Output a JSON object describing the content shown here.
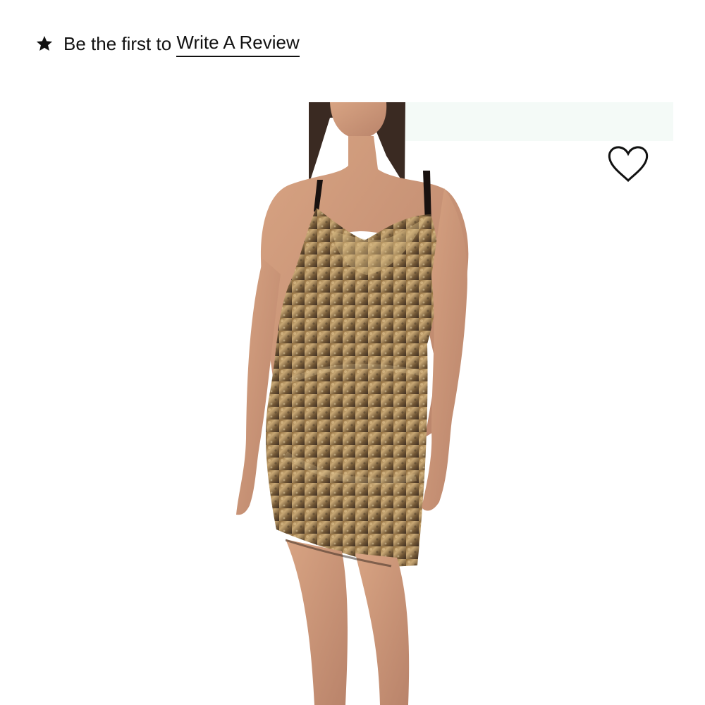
{
  "review": {
    "star_icon": "star-icon",
    "prefix": "Be the first to ",
    "link_label": "Write A Review"
  },
  "product": {
    "image_subject": "woman wearing gold sequin mini slip dress",
    "wishlist_icon": "heart-outline-icon"
  },
  "colors": {
    "text": "#111111",
    "background": "#ffffff",
    "dress_gold": "#a7864f"
  }
}
